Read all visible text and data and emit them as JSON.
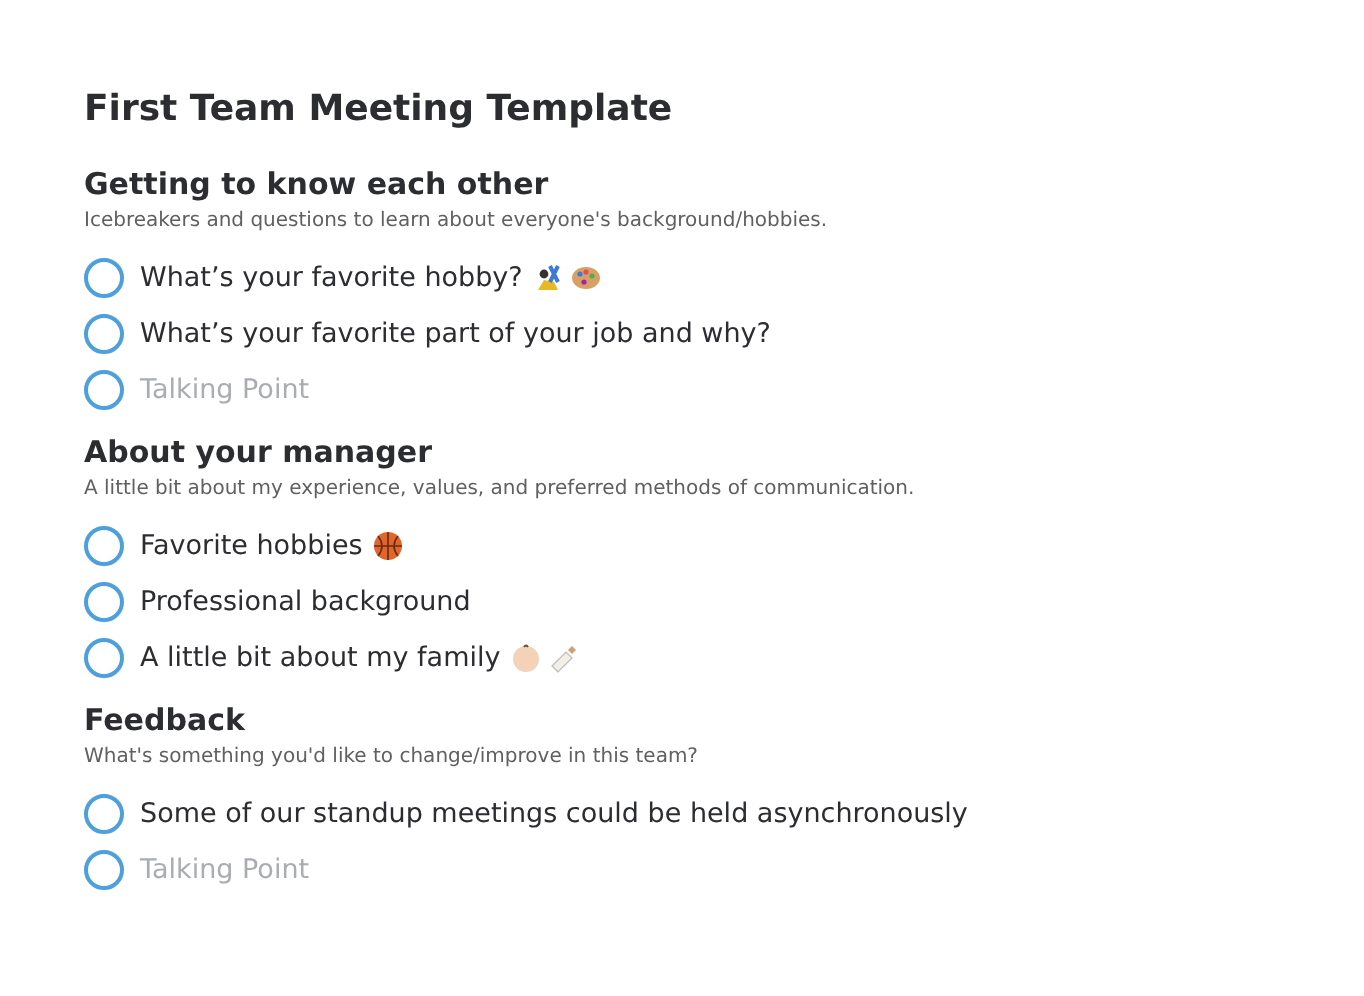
{
  "title": "First Team Meeting Template",
  "sections": [
    {
      "heading": "Getting to know each other",
      "description": "Icebreakers and questions to learn about everyone's background/hobbies.",
      "items": [
        {
          "kind": "topic",
          "checked": false,
          "text": "What’s your favorite hobby?",
          "icons": [
            {
              "kind": "juggler"
            },
            {
              "kind": "palette"
            }
          ]
        },
        {
          "kind": "topic",
          "checked": false,
          "text": "What’s your favorite part of your job and why?"
        },
        {
          "kind": "placeholder",
          "checked": false,
          "text": "Talking Point"
        }
      ]
    },
    {
      "heading": "About your manager",
      "description": "A little bit about my experience, values, and preferred methods of communication.",
      "items": [
        {
          "kind": "topic",
          "checked": false,
          "text": "Favorite hobbies",
          "icons": [
            {
              "kind": "basketball"
            }
          ]
        },
        {
          "kind": "topic",
          "checked": false,
          "text": "Professional background"
        },
        {
          "kind": "topic",
          "checked": false,
          "text": "A little bit about my family",
          "icons": [
            {
              "kind": "baby"
            },
            {
              "kind": "bottle"
            }
          ]
        }
      ]
    },
    {
      "heading": "Feedback",
      "description": "What's something you'd like to change/improve in this team?",
      "items": [
        {
          "kind": "topic",
          "checked": false,
          "text": "Some of our standup meetings could be held asynchronously"
        },
        {
          "kind": "placeholder",
          "checked": false,
          "text": "Talking Point"
        }
      ]
    }
  ]
}
